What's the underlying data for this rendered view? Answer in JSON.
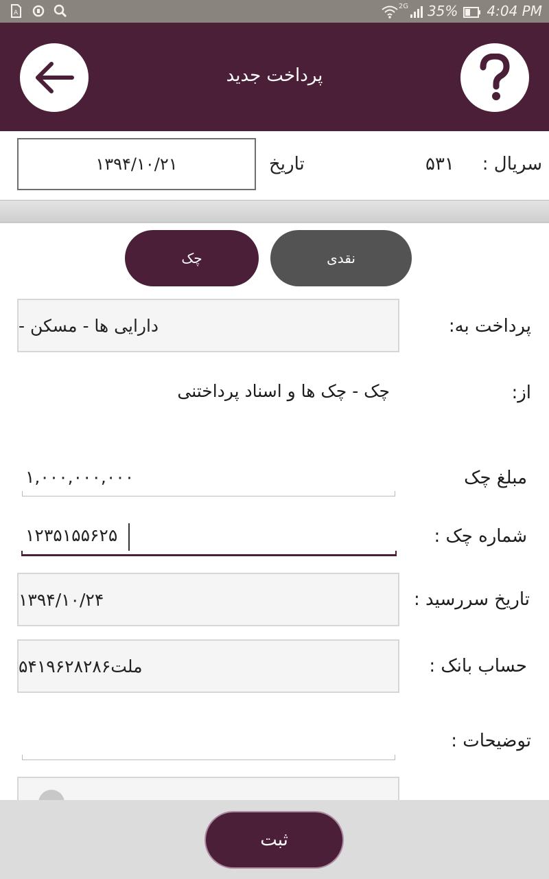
{
  "status_bar": {
    "battery_percent": "35%",
    "time": "4:04 PM",
    "network": "2G"
  },
  "header": {
    "title": "پرداخت جدید",
    "back_icon": "arrow-left-icon",
    "help_icon": "question-mark-icon"
  },
  "serial_row": {
    "serial_label": "سریال :",
    "serial_value": "۵۳۱",
    "date_label": "تاریخ",
    "date_value": "۱۳۹۴/۱۰/۲۱"
  },
  "payment_type": {
    "cash_label": "نقدی",
    "cheque_label": "چک",
    "selected": "چک"
  },
  "form": {
    "pay_to_label": "پرداخت به:",
    "pay_to_value": "دارایی ها - مسکن -",
    "from_label": "از:",
    "from_value": "چک - چک ها و اسناد پرداختنی",
    "amount_label": "مبلغ چک",
    "amount_value": "۱,۰۰۰,۰۰۰,۰۰۰",
    "cheque_number_label": "شماره چک :",
    "cheque_number_value": "۱۲۳۵۱۵۵۶۲۵",
    "due_date_label": "تاریخ سررسید :",
    "due_date_value": "۱۳۹۴/۱۰/۲۴",
    "bank_account_label": "حساب بانک :",
    "bank_account_value": "ملت۵۴۱۹۶۲۸۲۸۶",
    "description_label": "توضیحات :",
    "description_value": ""
  },
  "footer": {
    "submit_label": "ثبت"
  },
  "colors": {
    "primary": "#4a1f37",
    "secondary_button": "#535353",
    "status_bar": "#8a847e"
  }
}
